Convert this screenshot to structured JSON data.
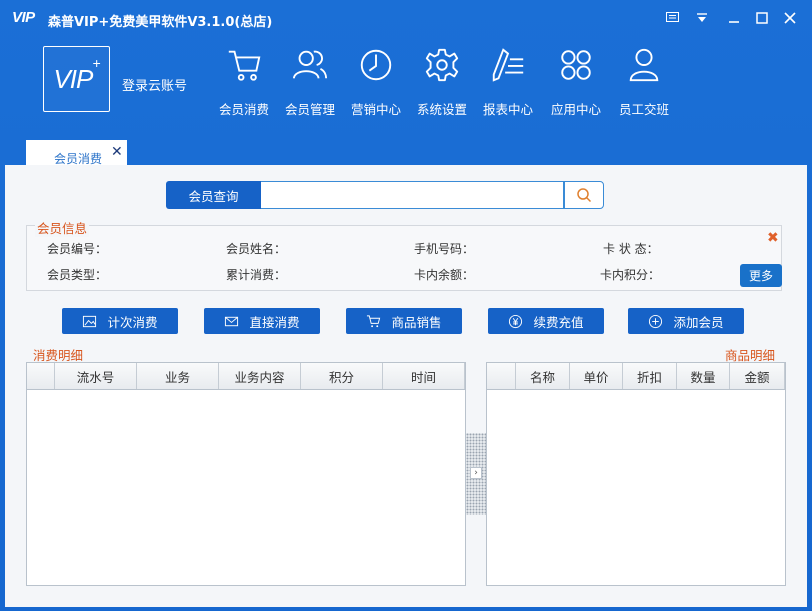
{
  "window": {
    "logo_text": "VIP",
    "title": "森普VIP+免费美甲软件V3.1.0(总店)",
    "controls": [
      "menu",
      "dropdown",
      "minimize",
      "maximize",
      "close"
    ]
  },
  "header": {
    "logo": "VIP+",
    "login_link": "登录云账号",
    "nav": [
      {
        "label": "会员消费",
        "icon": "shopping-cart-icon"
      },
      {
        "label": "会员管理",
        "icon": "users-icon"
      },
      {
        "label": "营销中心",
        "icon": "clock-icon"
      },
      {
        "label": "系统设置",
        "icon": "gear-icon"
      },
      {
        "label": "报表中心",
        "icon": "report-pen-icon"
      },
      {
        "label": "应用中心",
        "icon": "apps-grid-icon"
      },
      {
        "label": "员工交班",
        "icon": "user-icon"
      }
    ]
  },
  "tabs": [
    {
      "label": "会员消费",
      "active": true
    }
  ],
  "search": {
    "button_label": "会员查询",
    "value": "",
    "placeholder": ""
  },
  "member_info": {
    "title": "会员信息",
    "labels": [
      "会员编号：",
      "会员姓名：",
      "手机号码：",
      "卡 状 态：",
      "会员类型：",
      "累计消费：",
      "卡内余额：",
      "卡内积分："
    ],
    "more_label": "更多"
  },
  "actions": [
    {
      "label": "计次消费",
      "icon": "image-icon"
    },
    {
      "label": "直接消费",
      "icon": "mail-icon"
    },
    {
      "label": "商品销售",
      "icon": "cart-icon"
    },
    {
      "label": "续费充值",
      "icon": "yen-icon"
    },
    {
      "label": "添加会员",
      "icon": "plus-circle-icon"
    }
  ],
  "consume_detail": {
    "title": "消费明细",
    "columns": [
      "",
      "流水号",
      "业务",
      "业务内容",
      "积分",
      "时间"
    ]
  },
  "product_detail": {
    "title": "商品明细",
    "columns": [
      "",
      "名称",
      "单价",
      "折扣",
      "数量",
      "金额"
    ]
  },
  "colors": {
    "primary": "#1667cf",
    "accent_orange": "#d8561e",
    "button": "#1662c7"
  }
}
